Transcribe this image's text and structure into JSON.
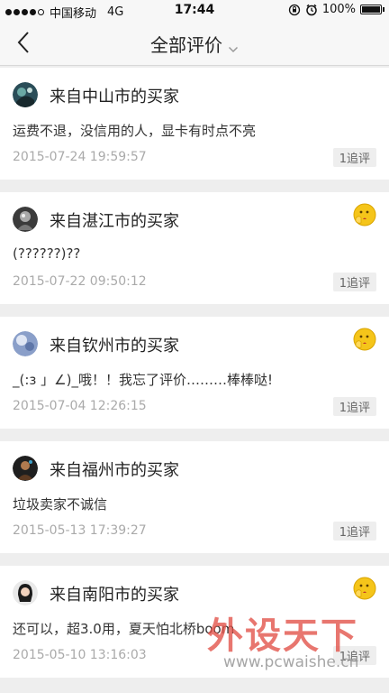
{
  "status_bar": {
    "carrier": "中国移动",
    "network": "4G",
    "time": "17:44",
    "battery": "100%",
    "icons": [
      "signal-icon",
      "rotation-lock-icon",
      "alarm-icon",
      "battery-icon"
    ]
  },
  "nav": {
    "title": "全部评价",
    "back_icon": "back-arrow-icon",
    "dropdown_icon": "chevron-down-icon"
  },
  "reviews": [
    {
      "buyer": "来自中山市的买家",
      "comment": "运费不退，没信用的人，显卡有时点不亮",
      "date": "2015-07-24 19:59:57",
      "followup": "1追评",
      "has_emoji_badge": false
    },
    {
      "buyer": "来自湛江市的买家",
      "comment": "(??????)??",
      "date": "2015-07-22 09:50:12",
      "followup": "1追评",
      "has_emoji_badge": true
    },
    {
      "buyer": "来自钦州市的买家",
      "comment": "_(:з 」∠)_哦！！我忘了评价………棒棒哒!",
      "date": "2015-07-04 12:26:15",
      "followup": "1追评",
      "has_emoji_badge": true
    },
    {
      "buyer": "来自福州市的买家",
      "comment": "垃圾卖家不诚信",
      "date": "2015-05-13 17:39:27",
      "followup": "1追评",
      "has_emoji_badge": false
    },
    {
      "buyer": "来自南阳市的买家",
      "comment": "还可以，超3.0用，夏天怕北桥boom",
      "date": "2015-05-10 13:16:03",
      "followup": "1追评",
      "has_emoji_badge": true
    }
  ],
  "watermark": {
    "main": "外设天下",
    "sub": "www.pcwaishe.cn"
  },
  "colors": {
    "page_bg": "#eeeeee",
    "card_bg": "#ffffff",
    "badge_yellow": "#f5c51a",
    "date_gray": "#aaaaaa"
  }
}
